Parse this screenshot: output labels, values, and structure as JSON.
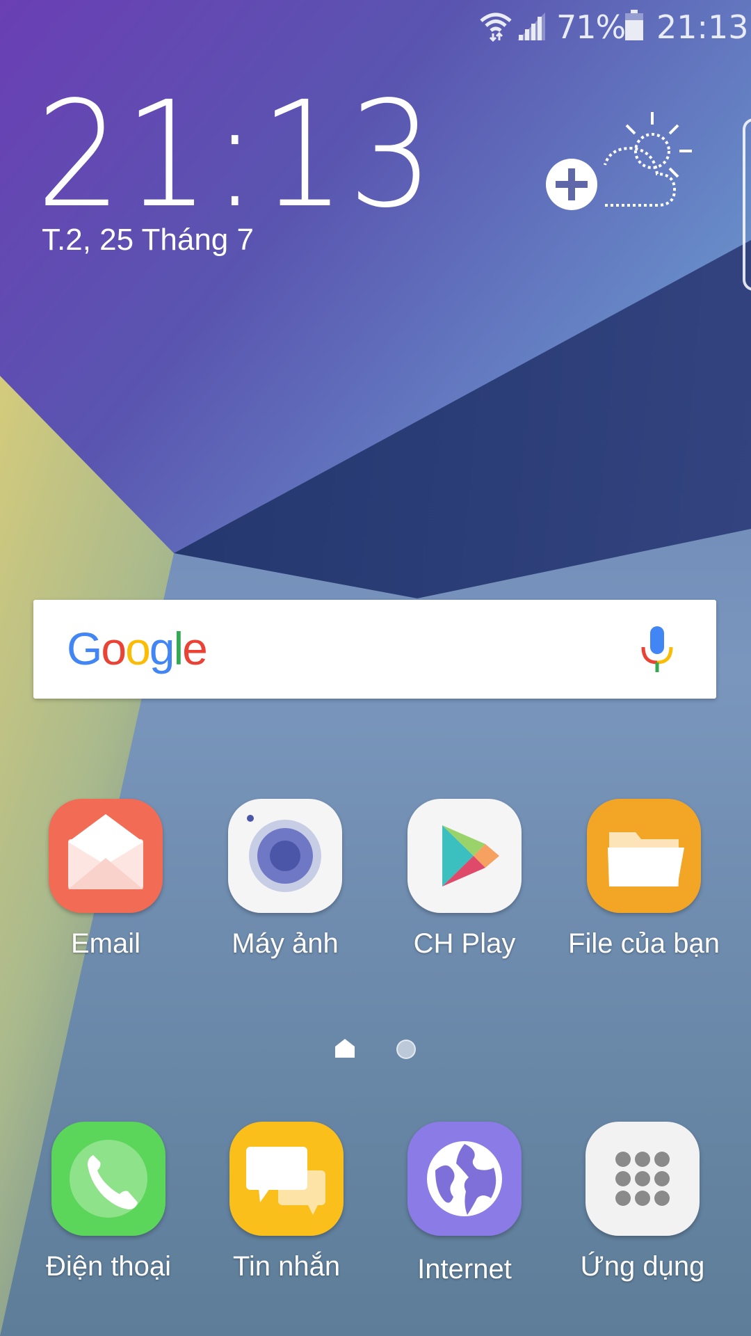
{
  "status_bar": {
    "battery_percent": "71%",
    "time": "21:13"
  },
  "clock_widget": {
    "time": "21:13",
    "date": "T.2, 25 Tháng 7"
  },
  "search": {
    "logo_letters": [
      "G",
      "o",
      "o",
      "g",
      "l",
      "e"
    ]
  },
  "home_apps": [
    {
      "label": "Email",
      "icon": "email-icon"
    },
    {
      "label": "Máy ảnh",
      "icon": "camera-icon"
    },
    {
      "label": "CH Play",
      "icon": "play-store-icon"
    },
    {
      "label": "File của bạn",
      "icon": "folder-icon"
    }
  ],
  "dock_apps": [
    {
      "label": "Điện thoại",
      "icon": "phone-icon"
    },
    {
      "label": "Tin nhắn",
      "icon": "messages-icon"
    },
    {
      "label": "Internet",
      "icon": "globe-icon"
    },
    {
      "label": "Ứng dụng",
      "icon": "apps-grid-icon"
    }
  ],
  "colors": {
    "email": "#f26b55",
    "camera": "#f5f5f5",
    "play_store": "#f5f5f5",
    "files": "#f3a626",
    "phone": "#5bd65a",
    "messages": "#fbbf1c",
    "internet": "#8b7be6",
    "apps": "#f2f2f2"
  }
}
